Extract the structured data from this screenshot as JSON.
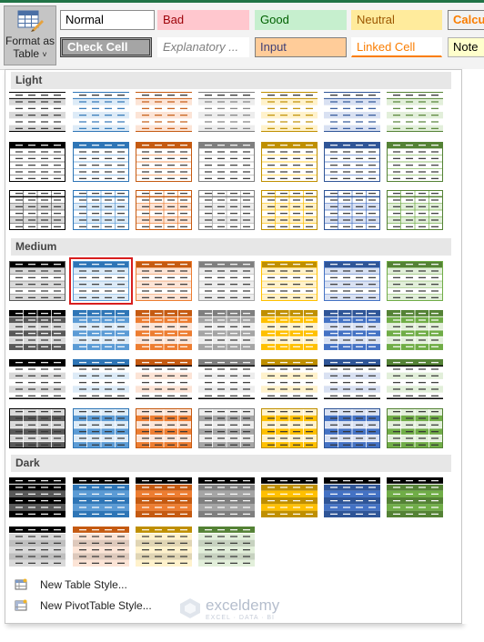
{
  "ribbon": {
    "format_as_table": {
      "line1": "Format as",
      "line2": "Table",
      "dropdown_glyph": "˅",
      "icon": "table-grid-icon"
    },
    "cell_styles": [
      {
        "label": "Normal",
        "bg": "#ffffff",
        "fg": "#000000",
        "border": "#8c8c8c",
        "italic": false,
        "bold": false,
        "underline": false
      },
      {
        "label": "Bad",
        "bg": "#ffc7ce",
        "fg": "#9c0006",
        "border": "#ffc7ce",
        "italic": false,
        "bold": false,
        "underline": false
      },
      {
        "label": "Good",
        "bg": "#c6efce",
        "fg": "#006100",
        "border": "#c6efce",
        "italic": false,
        "bold": false,
        "underline": false
      },
      {
        "label": "Neutral",
        "bg": "#ffeb9c",
        "fg": "#9c5700",
        "border": "#ffeb9c",
        "italic": false,
        "bold": false,
        "underline": false
      },
      {
        "label": "Calcul",
        "bg": "#f2f2f2",
        "fg": "#fa7d00",
        "border": "#7f7f7f",
        "italic": false,
        "bold": true,
        "underline": false
      },
      {
        "label": "Check Cell",
        "bg": "#a5a5a5",
        "fg": "#ffffff",
        "border": "#3f3f3f",
        "italic": false,
        "bold": true,
        "underline": false
      },
      {
        "label": "Explanatory ...",
        "bg": "#ffffff",
        "fg": "#7f7f7f",
        "border": "#ffffff",
        "italic": true,
        "bold": false,
        "underline": false
      },
      {
        "label": "Input",
        "bg": "#ffcc99",
        "fg": "#3f3f76",
        "border": "#7f7f7f",
        "italic": false,
        "bold": false,
        "underline": false
      },
      {
        "label": "Linked Cell",
        "bg": "#ffffff",
        "fg": "#fa7d00",
        "border": "#ffffff",
        "italic": false,
        "bold": false,
        "underline": true
      },
      {
        "label": "Note",
        "bg": "#ffffcc",
        "fg": "#000000",
        "border": "#b2b2b2",
        "italic": false,
        "bold": false,
        "underline": false
      }
    ]
  },
  "gallery": {
    "sections": [
      {
        "title": "Light"
      },
      {
        "title": "Medium"
      },
      {
        "title": "Dark"
      }
    ],
    "palette": [
      {
        "name": "black",
        "dark": "#000000",
        "mid": "#595959",
        "light": "#d9d9d9"
      },
      {
        "name": "blue",
        "dark": "#2e75b6",
        "mid": "#5b9bd5",
        "light": "#ddebf7"
      },
      {
        "name": "orange",
        "dark": "#c55a11",
        "mid": "#ed7d31",
        "light": "#fce4d6"
      },
      {
        "name": "gray",
        "dark": "#7f7f7f",
        "mid": "#a5a5a5",
        "light": "#ededed"
      },
      {
        "name": "gold",
        "dark": "#bf8f00",
        "mid": "#ffc000",
        "light": "#fff2cc"
      },
      {
        "name": "navy",
        "dark": "#2f5597",
        "mid": "#4472c4",
        "light": "#d9e1f2"
      },
      {
        "name": "green",
        "dark": "#548235",
        "mid": "#70ad47",
        "light": "#e2efda"
      }
    ],
    "light_rows": [
      "light-banded",
      "light-header",
      "light-grid"
    ],
    "medium_rows": [
      "medium-banded",
      "medium-grid",
      "medium-header-banded",
      "medium-filled-grid"
    ],
    "dark_rows": [
      {
        "variant": "dark-banded",
        "colors": [
          "black",
          "blue",
          "orange",
          "gray",
          "gold",
          "navy",
          "green"
        ]
      },
      {
        "variant": "dark-header-light",
        "colors": [
          "black",
          "orange",
          "gold",
          "green"
        ]
      }
    ],
    "selected": {
      "section": "Medium",
      "row": 0,
      "col": 1
    }
  },
  "menu": {
    "new_table_style": {
      "label": "New Table Style...",
      "icon": "new-table-style-icon"
    },
    "new_pivot_style": {
      "label": "New PivotTable Style...",
      "icon": "new-pivot-style-icon"
    }
  },
  "watermark": {
    "name": "exceldemy",
    "sub": "EXCEL · DATA · BI"
  }
}
